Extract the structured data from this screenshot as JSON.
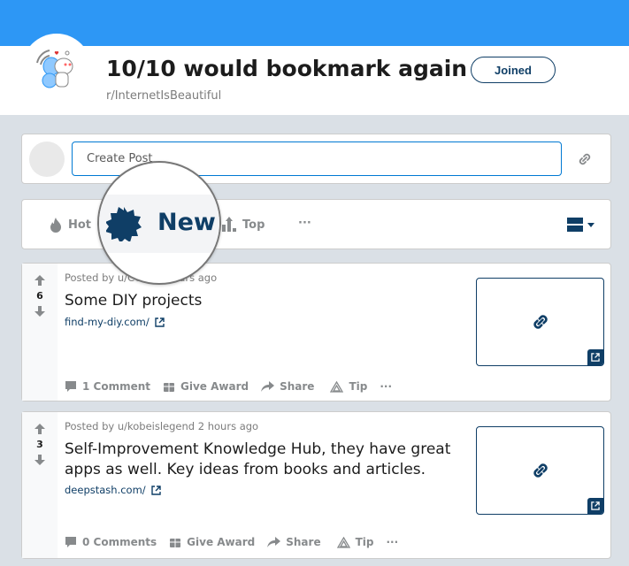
{
  "header": {
    "title": "10/10 would bookmark again",
    "subreddit": "r/InternetIsBeautiful",
    "joined_label": "Joined",
    "banner_color": "#2d97f5"
  },
  "create_post": {
    "placeholder": "Create Post"
  },
  "sort": {
    "hot": "Hot",
    "new": "New",
    "top": "Top",
    "more": "···",
    "active": "New"
  },
  "posts": [
    {
      "votes": "6",
      "meta": "Posted by u/CC",
      "meta_tail": "urs ago",
      "title": "Some DIY projects",
      "link": "find-my-diy.com/",
      "comments": "1 Comment",
      "award": "Give Award",
      "share": "Share",
      "tip": "Tip",
      "more": "···"
    },
    {
      "votes": "3",
      "meta": "Posted by u/kobeislegend 2 hours ago",
      "title": "Self-Improvement Knowledge Hub, they have great apps as well. Key ideas from books and articles.",
      "link": "deepstash.com/",
      "comments": "0 Comments",
      "award": "Give Award",
      "share": "Share",
      "tip": "Tip",
      "more": "···"
    }
  ]
}
